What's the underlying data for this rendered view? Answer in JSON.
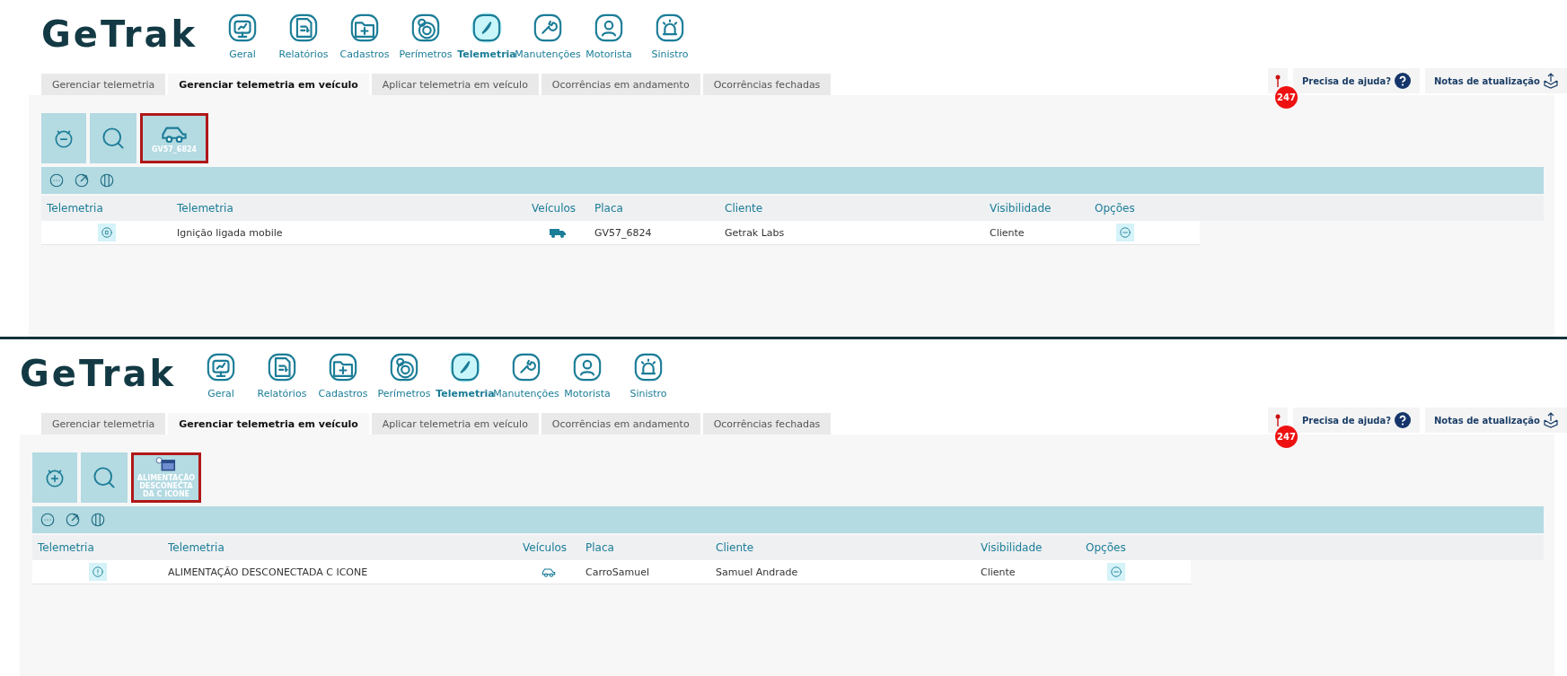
{
  "panels": [
    {
      "logo": "GeTrak",
      "nav": [
        {
          "label": "Geral",
          "selected": false
        },
        {
          "label": "Relatórios",
          "selected": false
        },
        {
          "label": "Cadastros",
          "selected": false
        },
        {
          "label": "Perímetros",
          "selected": false
        },
        {
          "label": "Telemetria",
          "selected": true
        },
        {
          "label": "Manutenções",
          "selected": false
        },
        {
          "label": "Motorista",
          "selected": false
        },
        {
          "label": "Sinistro",
          "selected": false
        }
      ],
      "tabs": [
        {
          "label": "Gerenciar telemetria",
          "selected": false
        },
        {
          "label": "Gerenciar telemetria em veículo",
          "selected": true
        },
        {
          "label": "Aplicar telemetria em veículo",
          "selected": false
        },
        {
          "label": "Ocorrências em andamento",
          "selected": false
        },
        {
          "label": "Ocorrências fechadas",
          "selected": false
        }
      ],
      "alert_count": "247",
      "help": "Precisa de ajuda?",
      "notes": "Notas de atualização",
      "filter": {
        "kind": "vehicle",
        "label": "GV57_6824",
        "highlighted": true
      },
      "columns": [
        "Telemetria",
        "Telemetria",
        "Veículos",
        "Placa",
        "Cliente",
        "Visibilidade",
        "Opções"
      ],
      "rows": [
        {
          "telemetria": "Ignição ligada mobile",
          "placa": "GV57_6824",
          "cliente": "Getrak Labs",
          "visibilidade": "Cliente"
        }
      ]
    },
    {
      "logo": "GeTrak",
      "nav": [
        {
          "label": "Geral",
          "selected": false
        },
        {
          "label": "Relatórios",
          "selected": false
        },
        {
          "label": "Cadastros",
          "selected": false
        },
        {
          "label": "Perímetros",
          "selected": false
        },
        {
          "label": "Telemetria",
          "selected": true
        },
        {
          "label": "Manutenções",
          "selected": false
        },
        {
          "label": "Motorista",
          "selected": false
        },
        {
          "label": "Sinistro",
          "selected": false
        }
      ],
      "tabs": [
        {
          "label": "Gerenciar telemetria",
          "selected": false
        },
        {
          "label": "Gerenciar telemetria em veículo",
          "selected": true
        },
        {
          "label": "Aplicar telemetria em veículo",
          "selected": false
        },
        {
          "label": "Ocorrências em andamento",
          "selected": false
        },
        {
          "label": "Ocorrências fechadas",
          "selected": false
        }
      ],
      "alert_count": "247",
      "help": "Precisa de ajuda?",
      "notes": "Notas de atualização",
      "filter": {
        "kind": "telemetry",
        "label": "ALIMENTAÇÃO DESCONECTA DA C ICONE",
        "highlighted": true
      },
      "columns": [
        "Telemetria",
        "Telemetria",
        "Veículos",
        "Placa",
        "Cliente",
        "Visibilidade",
        "Opções"
      ],
      "rows": [
        {
          "telemetria": "ALIMENTAÇÃO DESCONECTADA C ICONE",
          "placa": "CarroSamuel",
          "cliente": "Samuel Andrade",
          "visibilidade": "Cliente"
        }
      ]
    }
  ]
}
